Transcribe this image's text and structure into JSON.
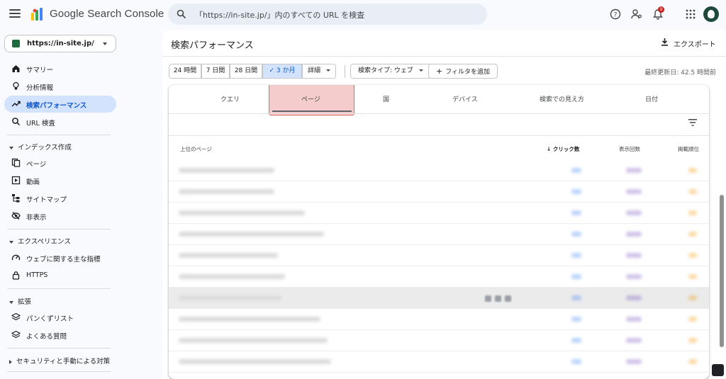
{
  "app": {
    "brand": "Google Search Console",
    "search_placeholder": "「https://in-site.jp/」内のすべての URL を検査",
    "notification_count": "9"
  },
  "sidebar": {
    "property": "https://in-site.jp/",
    "items_top": [
      {
        "label": "サマリー",
        "icon": "home-icon"
      },
      {
        "label": "分析情報",
        "icon": "lightbulb-icon"
      },
      {
        "label": "検索パフォーマンス",
        "icon": "trending-up-icon",
        "active": true
      },
      {
        "label": "URL 検査",
        "icon": "search-icon"
      }
    ],
    "index_section": {
      "title": "インデックス作成",
      "items": [
        {
          "label": "ページ",
          "icon": "pages-icon"
        },
        {
          "label": "動画",
          "icon": "video-icon"
        },
        {
          "label": "サイトマップ",
          "icon": "sitemap-icon"
        },
        {
          "label": "非表示",
          "icon": "hidden-icon"
        }
      ]
    },
    "experience_section": {
      "title": "エクスペリエンス",
      "items": [
        {
          "label": "ウェブに関する主な指標",
          "icon": "gauge-icon"
        },
        {
          "label": "HTTPS",
          "icon": "lock-icon"
        }
      ]
    },
    "enhancement_section": {
      "title": "拡張",
      "items": [
        {
          "label": "パンくずリスト",
          "icon": "layers-icon"
        },
        {
          "label": "よくある質問",
          "icon": "layers-icon"
        }
      ]
    },
    "security_section": {
      "title": "セキュリティと手動による対策"
    }
  },
  "main": {
    "title": "検索パフォーマンス",
    "export_label": "エクスポート",
    "date_ranges": [
      "24 時間",
      "7 日間",
      "28 日間",
      "3 か月",
      "詳細"
    ],
    "selected_range": "3 か月",
    "search_type": "検索タイプ: ウェブ",
    "add_filter": "フィルタを追加",
    "last_updated": "最終更新日: 42.5 時間前",
    "tabs": [
      "クエリ",
      "ページ",
      "国",
      "デバイス",
      "検索での見え方",
      "日付"
    ],
    "active_tab": "ページ",
    "table": {
      "columns": [
        "上位のページ",
        "クリック数",
        "表示回数",
        "掲載順位"
      ],
      "sorted_column": "クリック数"
    }
  },
  "colors": {
    "accent": "#0b57d0",
    "active_nav_bg": "#d3e3fd",
    "highlight_fill": "#f4cccc",
    "highlight_border": "#e06666",
    "clicks_color": "#4285f4",
    "impressions_color": "#7e57c2",
    "position_color": "#f29900"
  }
}
